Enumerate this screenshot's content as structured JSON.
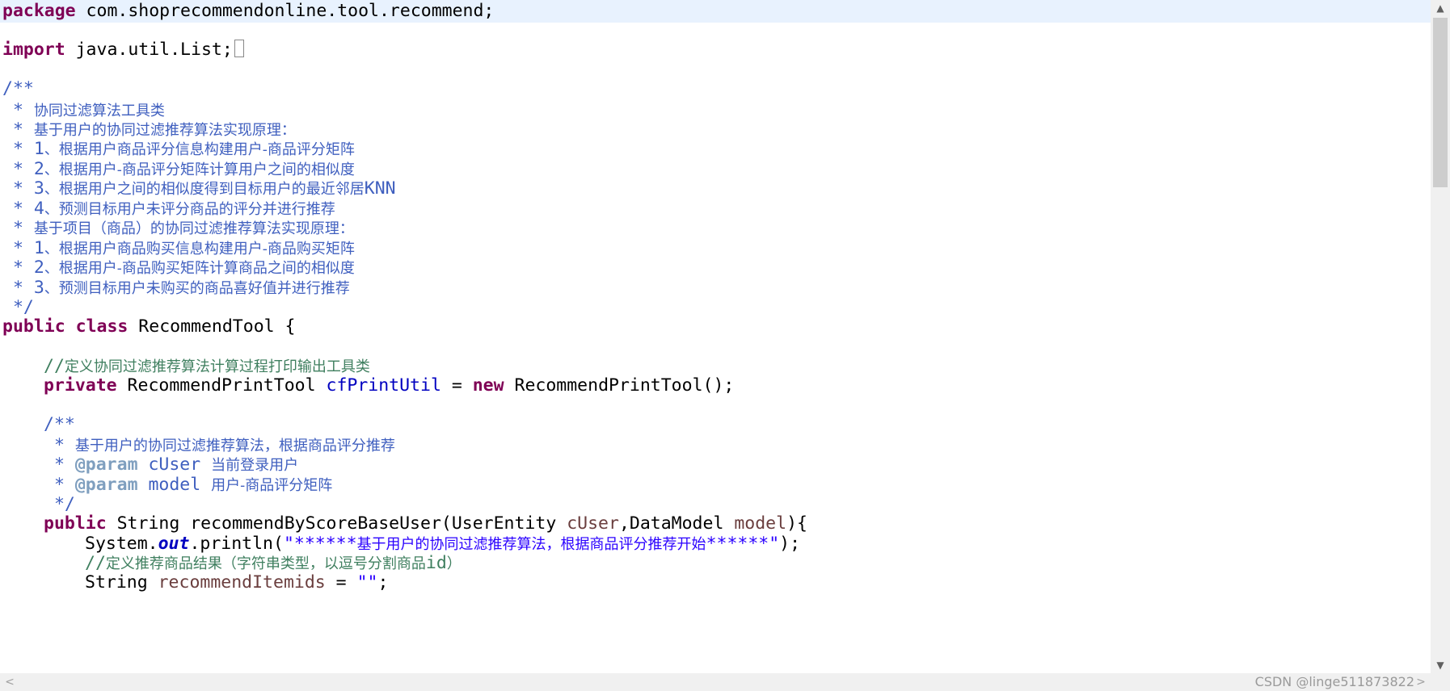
{
  "code": {
    "l1_kw": "package",
    "l1_rest": " com.shoprecommendonline.tool.recommend;",
    "l3_kw": "import",
    "l3_rest": " java.util.List;",
    "l5": "/**",
    "l6_star": " * ",
    "l6_text": "协同过滤算法工具类",
    "l7_text": "基于用户的协同过滤推荐算法实现原理：",
    "l8_num": "1",
    "l8_text": "、根据用户商品评分信息构建用户-商品评分矩阵",
    "l9_num": "2",
    "l9_text": "、根据用户-商品评分矩阵计算用户之间的相似度",
    "l10_num": "3",
    "l10_text": "、根据用户之间的相似度得到目标用户的最近邻居",
    "l10_knn": "KNN",
    "l11_num": "4",
    "l11_text": "、预测目标用户未评分商品的评分并进行推荐",
    "l12_text": "基于项目（商品）的协同过滤推荐算法实现原理：",
    "l13_num": "1",
    "l13_text": "、根据用户商品购买信息构建用户-商品购买矩阵",
    "l14_num": "2",
    "l14_text": "、根据用户-商品购买矩阵计算商品之间的相似度",
    "l15_num": "3",
    "l15_text": "、预测目标用户未购买的商品喜好值并进行推荐",
    "l16": " */",
    "l17_kw1": "public",
    "l17_kw2": "class",
    "l17_rest": " RecommendTool {",
    "l19_slash": "//",
    "l19_text": "定义协同过滤推荐算法计算过程打印输出工具类",
    "l20_kw": "private",
    "l20_type": " RecommendPrintTool ",
    "l20_field": "cfPrintUtil",
    "l20_eq": " = ",
    "l20_new": "new",
    "l20_rest": " RecommendPrintTool();",
    "l22": "/**",
    "l23_text": "基于用户的协同过滤推荐算法，根据商品评分推荐",
    "l24_tag": "@param",
    "l24_name": " cUser ",
    "l24_text": "当前登录用户",
    "l25_tag": "@param",
    "l25_name": " model ",
    "l25_text": "用户-商品评分矩阵",
    "l26": " */",
    "l27_kw": "public",
    "l27_a": " String recommendByScoreBaseUser(UserEntity ",
    "l27_p1": "cUser",
    "l27_b": ",DataModel ",
    "l27_p2": "model",
    "l27_c": "){",
    "l28_a": "System.",
    "l28_out": "out",
    "l28_b": ".println(",
    "l28_s1": "\"******",
    "l28_sz": "基于用户的协同过滤推荐算法，根据商品评分推荐开始",
    "l28_s2": "******\"",
    "l28_c": ");",
    "l29_slash": "//",
    "l29_text": "定义推荐商品结果（字符串类型，以逗号分割商品",
    "l29_id": "id",
    "l29_close": "）",
    "l30_a": "String ",
    "l30_var": "recommendItemids",
    "l30_b": " = ",
    "l30_str": "\"\"",
    "l30_c": ";"
  },
  "scrollbar": {
    "up_icon": "▲",
    "down_icon": "▼",
    "left_icon": "<",
    "right_icon": ">"
  },
  "watermark": "CSDN @linge511873822",
  "colors": {
    "keyword": "#7f0055",
    "javadoc": "#3f5fbf",
    "comment": "#3f7f5f",
    "field": "#0000c0",
    "string": "#2a00ff",
    "current_line": "#e8f2fe"
  }
}
